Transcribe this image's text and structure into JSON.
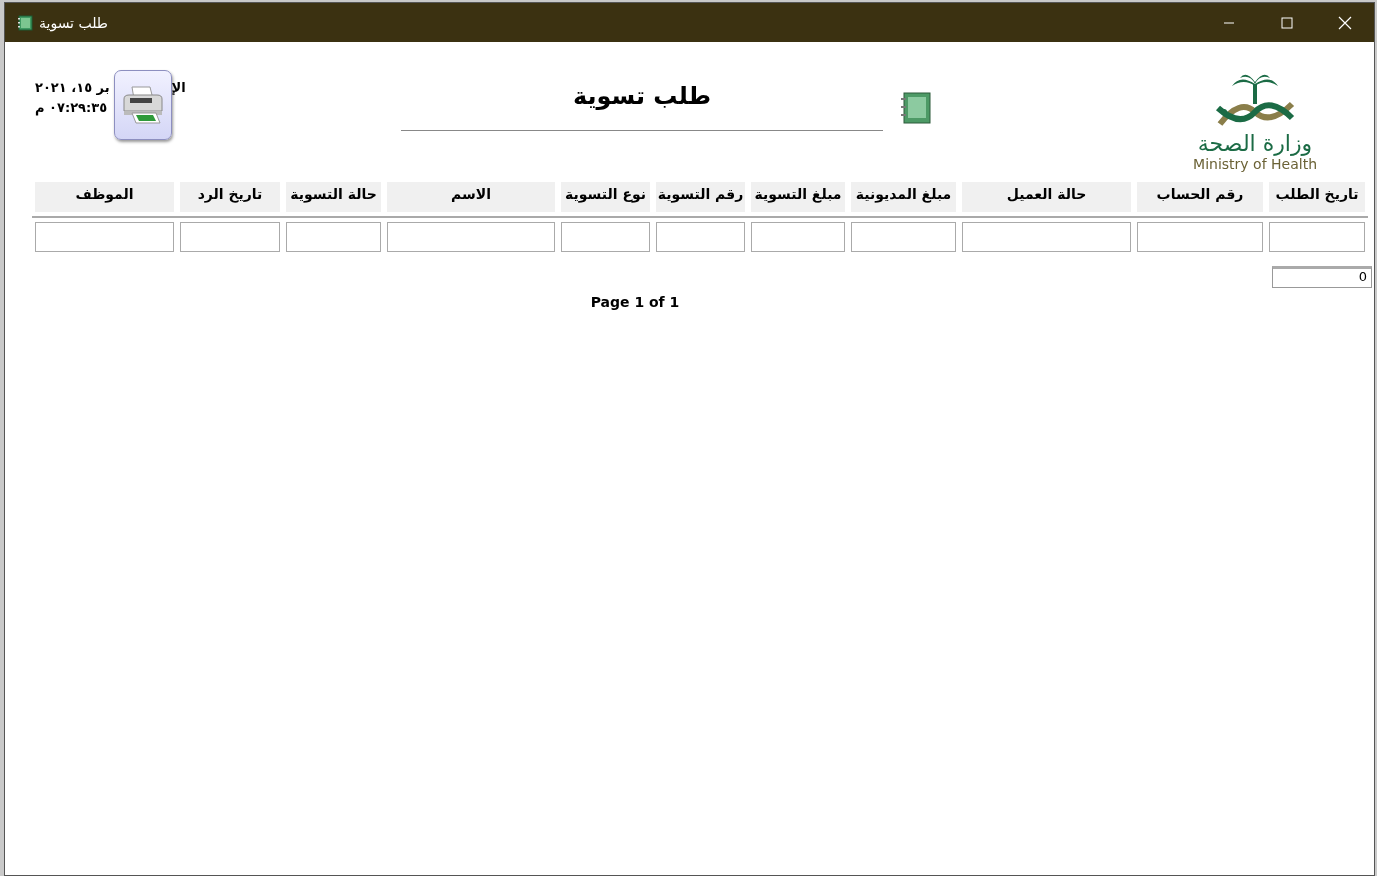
{
  "window": {
    "title": "طلب تسوية"
  },
  "header": {
    "date_visible_start": "الإ",
    "date_visible_end": "بر ١٥، ٢٠٢١",
    "time": "٠٧:٢٩:٣٥ م",
    "report_title": "طلب تسوية",
    "logo_arabic": "وزارة الصحة",
    "logo_english": "Ministry of Health"
  },
  "table": {
    "columns": [
      {
        "label": "تاريخ الطلب"
      },
      {
        "label": "رقم الحساب"
      },
      {
        "label": "حالة العميل"
      },
      {
        "label": "مبلغ المديونية"
      },
      {
        "label": "مبلغ التسوية"
      },
      {
        "label": "رقم التسوية"
      },
      {
        "label": "نوع التسوية"
      },
      {
        "label": "الاسم"
      },
      {
        "label": "حالة التسوية"
      },
      {
        "label": "تاريخ الرد"
      },
      {
        "label": "الموظف"
      }
    ]
  },
  "total_field": {
    "value": "0"
  },
  "footer": {
    "page": "Page 1 of 1"
  }
}
